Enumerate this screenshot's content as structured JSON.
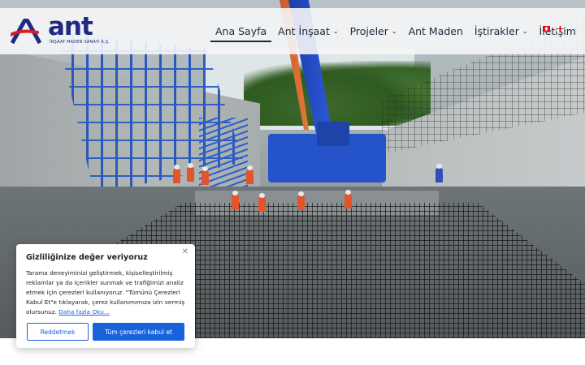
{
  "logo": {
    "word": "ant",
    "subtitle": "İNŞAAT MADEN SANAYİ A.Ş.",
    "brand_color": "#1f2a80",
    "accent_color": "#d32027"
  },
  "nav": {
    "items": [
      {
        "label": "Ana Sayfa",
        "active": true,
        "has_dropdown": false
      },
      {
        "label": "Ant İnşaat",
        "active": false,
        "has_dropdown": true
      },
      {
        "label": "Projeler",
        "active": false,
        "has_dropdown": true
      },
      {
        "label": "Ant Maden",
        "active": false,
        "has_dropdown": false
      },
      {
        "label": "İştirakler",
        "active": false,
        "has_dropdown": true
      },
      {
        "label": "İletişim",
        "active": false,
        "has_dropdown": false
      }
    ],
    "dropdown_icon": "chevron-down-icon",
    "languages": [
      "tr-flag-icon",
      "en-flag-icon"
    ]
  },
  "cookie": {
    "title": "Gizliliğinize değer veriyoruz",
    "body": "Tarama deneyiminizi geliştirmek, kişiselleştirilmiş reklamlar ya da içerikler sunmak ve trafiğimizi analiz etmek için çerezleri kullanıyoruz. \"Tümünü Çerezleri Kabul Et\"e tıklayarak, çerez kullanımımıza izin vermiş olursunuz.",
    "link": "Daha fazla Oku...",
    "reject_label": "Reddetmek",
    "accept_label": "Tüm çerezleri kabul et",
    "close_icon": "close-icon",
    "button_color": "#1863dc"
  }
}
